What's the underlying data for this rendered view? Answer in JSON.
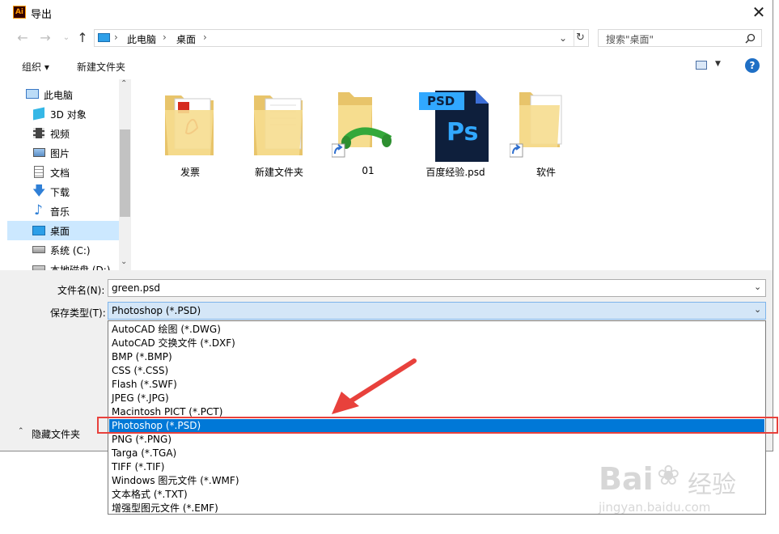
{
  "window": {
    "title": "导出",
    "app_icon_text": "Ai"
  },
  "address": {
    "crumbs": [
      "此电脑",
      "桌面"
    ]
  },
  "search": {
    "placeholder": "搜索\"桌面\""
  },
  "toolbar": {
    "organize_label": "组织 ▾",
    "new_folder_label": "新建文件夹"
  },
  "nav": {
    "items": [
      {
        "label": "此电脑",
        "icon": "computer-icon"
      },
      {
        "label": "3D 对象",
        "icon": "3d-objects-icon"
      },
      {
        "label": "视频",
        "icon": "video-icon"
      },
      {
        "label": "图片",
        "icon": "pictures-icon"
      },
      {
        "label": "文档",
        "icon": "documents-icon"
      },
      {
        "label": "下载",
        "icon": "download-icon"
      },
      {
        "label": "音乐",
        "icon": "music-icon"
      },
      {
        "label": "桌面",
        "icon": "desktop-icon",
        "selected": true
      },
      {
        "label": "系统 (C:)",
        "icon": "drive-icon"
      },
      {
        "label": "本地磁盘 (D:)",
        "icon": "drive-icon"
      }
    ]
  },
  "files": [
    {
      "name": "发票",
      "icon": "folder-pdf-icon"
    },
    {
      "name": "新建文件夹",
      "icon": "folder-icon"
    },
    {
      "name": "01",
      "icon": "folder-shortcut-icon"
    },
    {
      "name": "百度经验.psd",
      "icon": "psd-file-icon",
      "badge": "PSD",
      "ps": "Ps"
    },
    {
      "name": "软件",
      "icon": "folder-shortcut-icon"
    }
  ],
  "form": {
    "filename_label": "文件名(N):",
    "filename_value": "green.psd",
    "type_label": "保存类型(T):",
    "type_value": "Photoshop (*.PSD)"
  },
  "type_options": [
    "AutoCAD 绘图 (*.DWG)",
    "AutoCAD 交换文件 (*.DXF)",
    "BMP (*.BMP)",
    "CSS (*.CSS)",
    "Flash (*.SWF)",
    "JPEG (*.JPG)",
    "Macintosh PICT (*.PCT)",
    "Photoshop (*.PSD)",
    "PNG (*.PNG)",
    "Targa (*.TGA)",
    "TIFF (*.TIF)",
    "Windows 图元文件 (*.WMF)",
    "文本格式 (*.TXT)",
    "增强型图元文件 (*.EMF)"
  ],
  "selected_type_index": 7,
  "hide_folders_label": "隐藏文件夹",
  "watermark": {
    "brand": "Bai",
    "brand2": "经验",
    "url": "jingyan.baidu.com"
  },
  "colors": {
    "selection": "#0078d7",
    "highlight_box": "#e8413c",
    "arrow": "#e8413c"
  }
}
